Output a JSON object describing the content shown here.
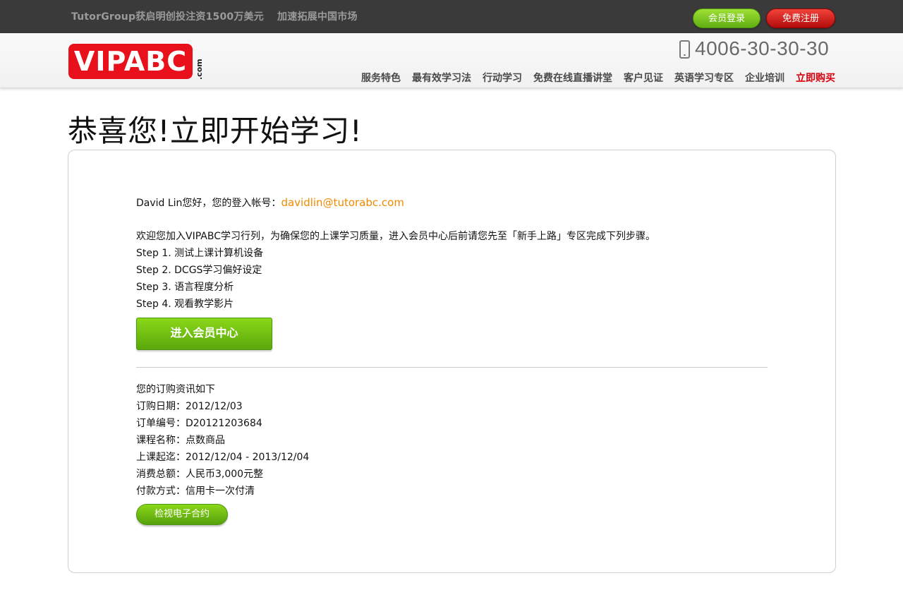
{
  "topbar": {
    "news": [
      "TutorGroup获启明创投注资1500万美元",
      "加速拓展中国市场"
    ],
    "login_label": "会员登录",
    "register_label": "免费注册"
  },
  "header": {
    "logo_text": "VIPABC",
    "logo_suffix": ".com",
    "phone": "4006-30-30-30",
    "nav": [
      "服务特色",
      "最有效学习法",
      "行动学习",
      "免费在线直播讲堂",
      "客户见证",
      "英语学习专区",
      "企业培训",
      "立即购买"
    ]
  },
  "main": {
    "title": "恭喜您!立即开始学习!",
    "greeting": "David Lin您好，您的登入帐号：",
    "email": "davidlin@tutorabc.com",
    "welcome": "欢迎您加入VIPABC学习行列，为确保您的上课学习质量，进入会员中心后前请您先至「新手上路」专区完成下列步骤。",
    "steps": [
      "Step 1. 测试上课计算机设备",
      "Step 2. DCGS学习偏好设定",
      "Step 3. 语言程度分析",
      "Step 4. 观看教学影片"
    ],
    "member_button": "进入会员中心",
    "order_heading": "您的订购资讯如下",
    "order": [
      "订购日期：2012/12/03",
      "订单编号：D20121203684",
      "课程名称：点数商品",
      "上课起迄：2012/12/04 - 2013/12/04",
      "消费总额：人民币3,000元整",
      "付款方式：信用卡一次付清"
    ],
    "contract_button": "检视电子合约"
  },
  "colors": {
    "topbar_bg": "#3a3a3a",
    "brand_red": "#e8101a",
    "accent_green": "#6cbf12",
    "email_orange": "#f08a00",
    "buy_red": "#d8000c"
  }
}
